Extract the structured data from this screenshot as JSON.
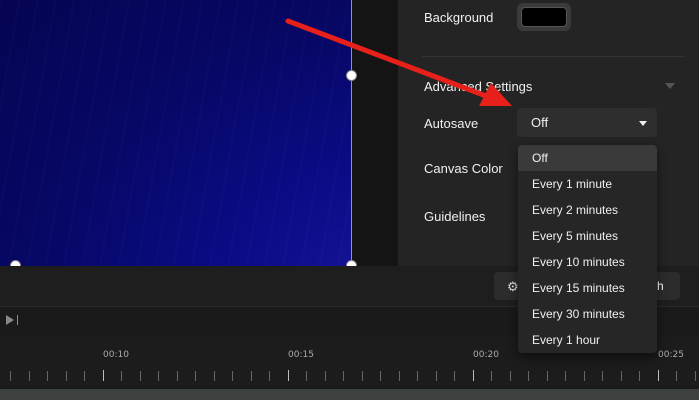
{
  "properties_panel": {
    "background_label": "Background",
    "background_color": "#000000",
    "advanced_settings_label": "Advanced Settings",
    "autosave_label": "Autosave",
    "autosave_value": "Off",
    "canvas_color_label": "Canvas Color",
    "guidelines_label": "Guidelines"
  },
  "autosave_dropdown": {
    "options": [
      "Off",
      "Every 1 minute",
      "Every 2 minutes",
      "Every 5 minutes",
      "Every 10 minutes",
      "Every 15 minutes",
      "Every 30 minutes",
      "Every 1 hour"
    ],
    "selected": "Off"
  },
  "toolbar": {
    "publish_label_visible": "sh",
    "gear_icon": "gear-icon"
  },
  "timeline": {
    "tick_labels": [
      "00:10",
      "00:15",
      "00:20",
      "00:25"
    ]
  },
  "colors": {
    "canvas_bg": "#0b0b86",
    "selection_line": "#5aa0ff",
    "annotation": "#e8201a",
    "panel_bg": "#242424"
  }
}
